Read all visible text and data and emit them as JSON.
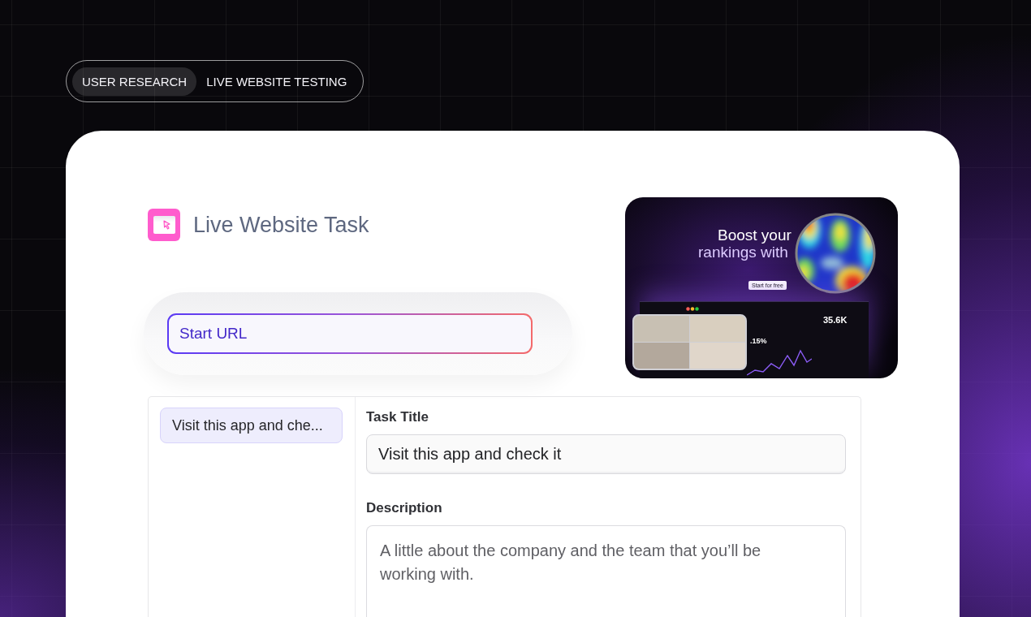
{
  "tags": [
    {
      "label": "USER RESEARCH",
      "selected": true
    },
    {
      "label": "LIVE WEBSITE TESTING",
      "selected": false
    }
  ],
  "task_header": {
    "title": "Live Website Task"
  },
  "start_url": {
    "placeholder": "Start URL"
  },
  "preview": {
    "headline": [
      "Boost your",
      "rankings with"
    ],
    "button": "Start for free",
    "stats": [
      ".15%",
      "35.6K"
    ]
  },
  "task_list": [
    {
      "label": "Visit this app and che...",
      "selected": true
    }
  ],
  "task_form": {
    "fields": [
      {
        "kind": "input",
        "label": "Task Title",
        "value": "Visit this app and check it"
      },
      {
        "kind": "textarea",
        "label": "Description",
        "placeholder": "A little about the company and the team that you’ll be working with."
      }
    ]
  }
}
